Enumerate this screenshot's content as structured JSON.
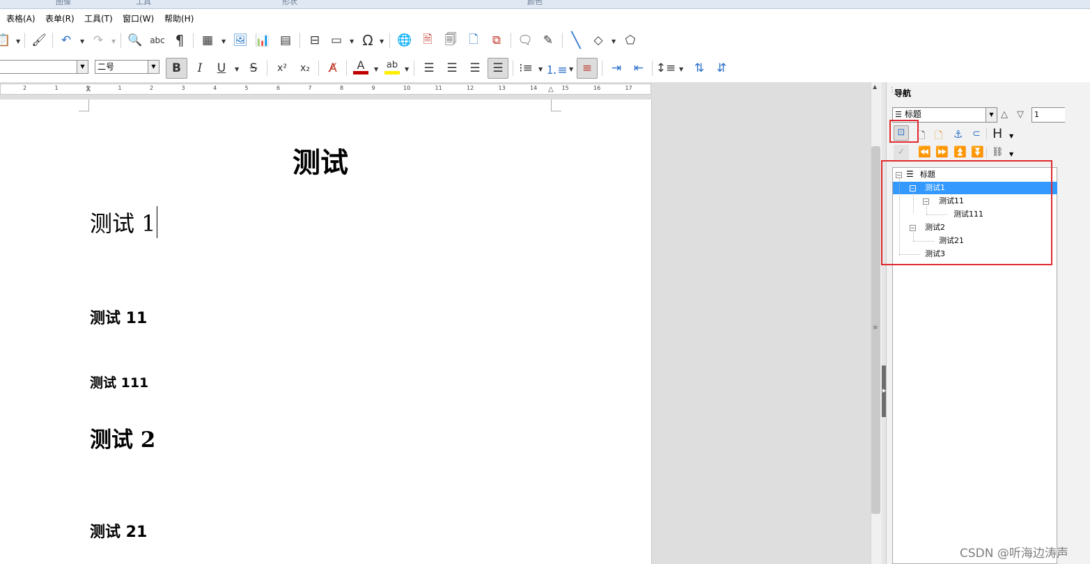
{
  "topstrip": {
    "labels": [
      "图像",
      "工具",
      "形状",
      "颜色"
    ]
  },
  "menubar": {
    "items": [
      "表格(A)",
      "表单(R)",
      "工具(T)",
      "窗口(W)",
      "帮助(H)"
    ]
  },
  "formatting": {
    "paragraph_style": "",
    "font_size": "二号",
    "bold_active": true,
    "font_color": "#c00000",
    "highlight_color": "#ffee00"
  },
  "ruler": {
    "numbers": [
      "2",
      "1",
      "1",
      "1",
      "2",
      "3",
      "4",
      "5",
      "6",
      "7",
      "8",
      "9",
      "10",
      "11",
      "12",
      "13",
      "14",
      "15",
      "16",
      "17"
    ]
  },
  "document": {
    "title": "测试",
    "headings": [
      {
        "text": "测试 1",
        "level": 1
      },
      {
        "text": "测试 11",
        "level": 2
      },
      {
        "text": "测试 111",
        "level": 3
      },
      {
        "text": "测试 2",
        "level": 1
      },
      {
        "text": "测试 21",
        "level": 2
      }
    ]
  },
  "navigator": {
    "title": "导航",
    "category_select": "标题",
    "page_number": "1",
    "tree": {
      "root": "标题",
      "items": [
        {
          "label": "测试1",
          "depth": 1,
          "selected": true,
          "expander": "⊟"
        },
        {
          "label": "测试11",
          "depth": 2,
          "selected": false,
          "expander": "⊟"
        },
        {
          "label": "测试111",
          "depth": 3,
          "selected": false,
          "expander": ""
        },
        {
          "label": "测试2",
          "depth": 1,
          "selected": false,
          "expander": "⊟"
        },
        {
          "label": "测试21",
          "depth": 2,
          "selected": false,
          "expander": ""
        },
        {
          "label": "测试3",
          "depth": 1,
          "selected": false,
          "expander": ""
        }
      ]
    }
  },
  "colors": {
    "selection": "#3399ff",
    "annotation_red": "#e0282e"
  },
  "watermark": "CSDN @听海边涛声"
}
